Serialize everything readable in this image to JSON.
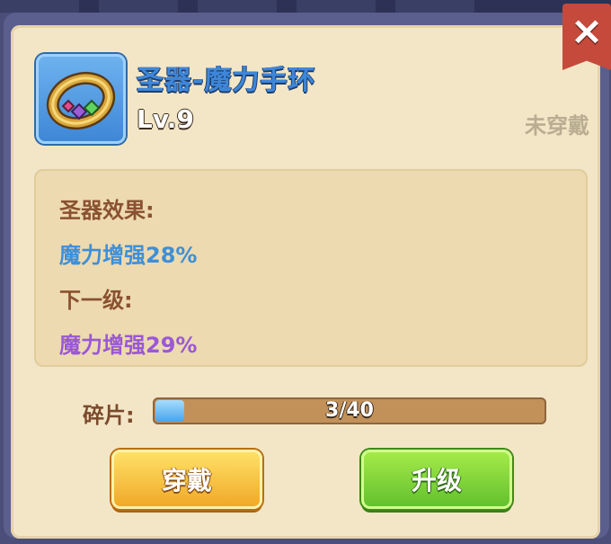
{
  "item": {
    "name": "圣器-魔力手环",
    "level": "Lv.9",
    "equip_status": "未穿戴",
    "icon": "bracelet-icon"
  },
  "effects": {
    "title": "圣器效果:",
    "current": "魔力增强28%",
    "next_title": "下一级:",
    "next": "魔力增强29%"
  },
  "shards": {
    "label": "碎片:",
    "text": "3/40",
    "progress": 0.075
  },
  "buttons": {
    "equip": "穿戴",
    "upgrade": "升级",
    "close": "close-icon"
  },
  "colors": {
    "current_effect": "#3f8fd6",
    "next_effect": "#9a58d4",
    "equip_button": "#f0a625",
    "upgrade_button": "#5fbf2c",
    "close_tab": "#c54a3c"
  }
}
